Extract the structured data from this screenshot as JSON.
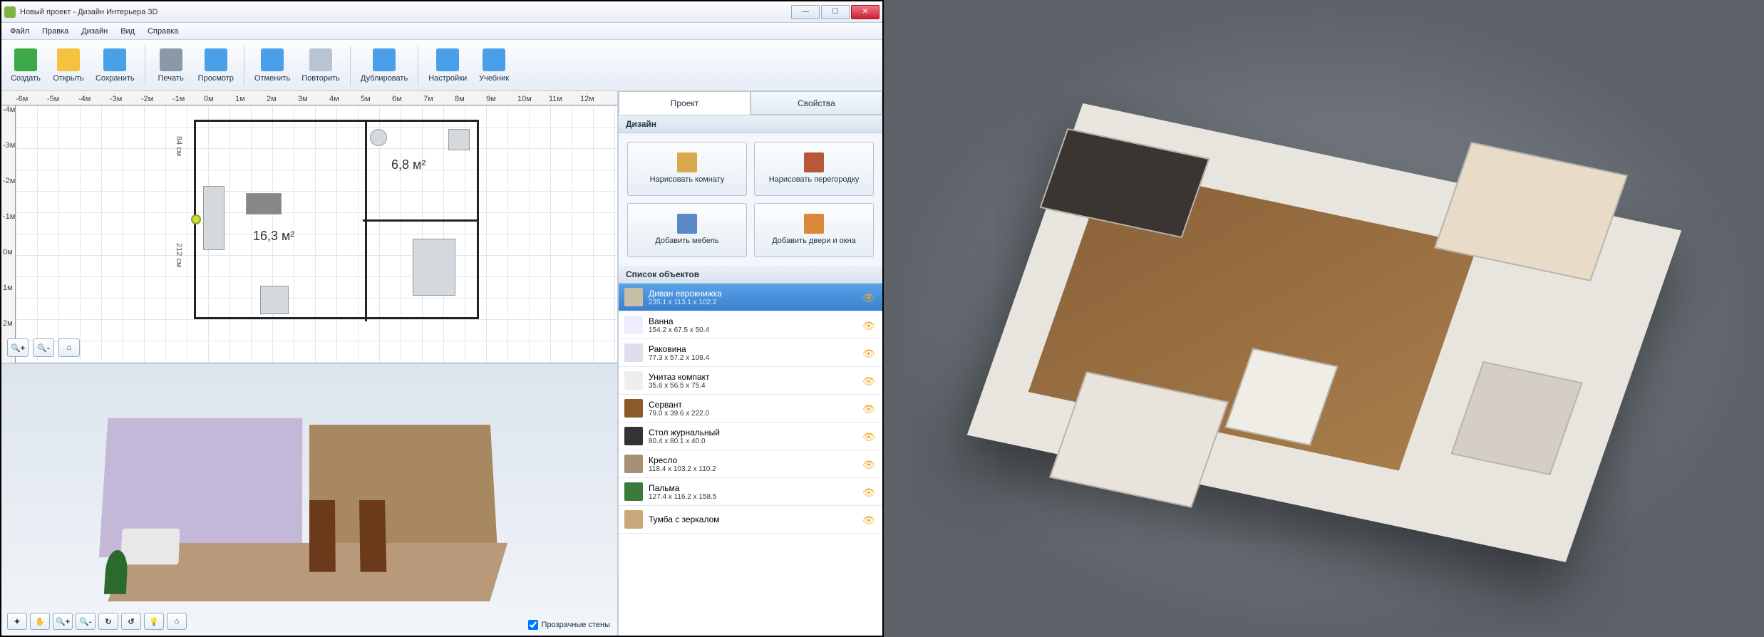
{
  "window": {
    "title": "Новый проект - Дизайн Интерьера 3D"
  },
  "menu": [
    "Файл",
    "Правка",
    "Дизайн",
    "Вид",
    "Справка"
  ],
  "toolbar": [
    {
      "label": "Создать",
      "color": "#3da848"
    },
    {
      "label": "Открыть",
      "color": "#f5c23e"
    },
    {
      "label": "Сохранить",
      "color": "#4aa0e8"
    },
    {
      "sep": true
    },
    {
      "label": "Печать",
      "color": "#8a98a8"
    },
    {
      "label": "Просмотр",
      "color": "#4aa0e8"
    },
    {
      "sep": true
    },
    {
      "label": "Отменить",
      "color": "#4aa0e8"
    },
    {
      "label": "Повторить",
      "color": "#b8c4d2"
    },
    {
      "sep": true
    },
    {
      "label": "Дублировать",
      "color": "#4aa0e8"
    },
    {
      "sep": true
    },
    {
      "label": "Настройки",
      "color": "#4aa0e8"
    },
    {
      "label": "Учебник",
      "color": "#4aa0e8"
    }
  ],
  "ruler_h": [
    "-6м",
    "-5м",
    "-4м",
    "-3м",
    "-2м",
    "-1м",
    "0м",
    "1м",
    "2м",
    "3м",
    "4м",
    "5м",
    "6м",
    "7м",
    "8м",
    "9м",
    "10м",
    "11м",
    "12м"
  ],
  "ruler_v": [
    "-4м",
    "-3м",
    "-2м",
    "-1м",
    "0м",
    "1м",
    "2м"
  ],
  "floorplan": {
    "room1_area": "16,3 м²",
    "room2_area": "6,8 м²",
    "dim_v1": "84 см",
    "dim_v2": "212 см"
  },
  "transparent_walls_label": "Прозрачные стены",
  "tabs": {
    "project": "Проект",
    "properties": "Свойства"
  },
  "design_section": "Дизайн",
  "design_buttons": [
    {
      "label": "Нарисовать\nкомнату",
      "color": "#d8a84a"
    },
    {
      "label": "Нарисовать\nперегородку",
      "color": "#b85838"
    },
    {
      "label": "Добавить\nмебель",
      "color": "#5a88c8"
    },
    {
      "label": "Добавить\nдвери и окна",
      "color": "#d88838"
    }
  ],
  "objects_section": "Список объектов",
  "objects": [
    {
      "name": "Диван еврокнижка",
      "dims": "235.1 x 113.1 x 102.2",
      "selected": true,
      "color": "#c8bea8"
    },
    {
      "name": "Ванна",
      "dims": "154.2 x 67.5 x 50.4",
      "color": "#eef"
    },
    {
      "name": "Раковина",
      "dims": "77.3 x 57.2 x 108.4",
      "color": "#dde"
    },
    {
      "name": "Унитаз компакт",
      "dims": "35.6 x 56.5 x 75.4",
      "color": "#eee"
    },
    {
      "name": "Сервант",
      "dims": "79.0 x 39.6 x 222.0",
      "color": "#8b5a2b"
    },
    {
      "name": "Стол журнальный",
      "dims": "80.4 x 80.1 x 40.0",
      "color": "#333"
    },
    {
      "name": "Кресло",
      "dims": "118.4 x 103.2 x 110.2",
      "color": "#a89078"
    },
    {
      "name": "Пальма",
      "dims": "127.4 x 116.2 x 158.5",
      "color": "#3a7a3a"
    },
    {
      "name": "Тумба с зеркалом",
      "dims": "",
      "color": "#c8a878"
    }
  ]
}
